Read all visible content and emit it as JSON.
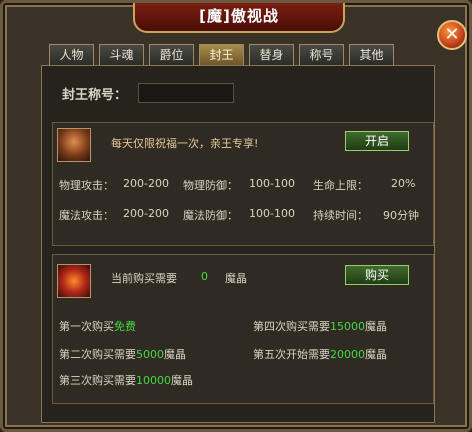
{
  "window": {
    "title": "[魔]傲视战",
    "close_symbol": "✕"
  },
  "tabs": [
    {
      "label": "人物"
    },
    {
      "label": "斗魂"
    },
    {
      "label": "爵位"
    },
    {
      "label": "封王"
    },
    {
      "label": "替身"
    },
    {
      "label": "称号"
    },
    {
      "label": "其他"
    }
  ],
  "active_tab": "封王",
  "title_field": {
    "label": "封王称号：",
    "value": ""
  },
  "blessing": {
    "icon": "crest-icon",
    "description": "每天仅限祝福一次，亲王专享!",
    "button": "开启",
    "stats": {
      "phys_atk_label": "物理攻击：",
      "phys_atk": "200-200",
      "phys_def_label": "物理防御：",
      "phys_def": "100-100",
      "hp_label": "生命上限：",
      "hp": "20%",
      "magic_atk_label": "魔法攻击：",
      "magic_atk": "200-200",
      "magic_def_label": "魔法防御：",
      "magic_def": "100-100",
      "duration_label": "持续时间：",
      "duration": "90分钟"
    }
  },
  "purchase": {
    "icon": "fire-orb-icon",
    "current_label": "当前购买需要",
    "current_value": "0",
    "current_unit": "魔晶",
    "button": "购买",
    "tiers": [
      {
        "prefix": "第一次购买",
        "value": "免费",
        "suffix": ""
      },
      {
        "prefix": "第二次购买需要",
        "value": "5000",
        "suffix": "魔晶"
      },
      {
        "prefix": "第三次购买需要",
        "value": "10000",
        "suffix": "魔晶"
      },
      {
        "prefix": "第四次购买需要",
        "value": "15000",
        "suffix": "魔晶"
      },
      {
        "prefix": "第五次开始需要",
        "value": "20000",
        "suffix": "魔晶"
      }
    ]
  },
  "colors": {
    "accent_green": "#44d844",
    "title_red": "#7a1e12",
    "gold_border": "#c9a45c"
  }
}
